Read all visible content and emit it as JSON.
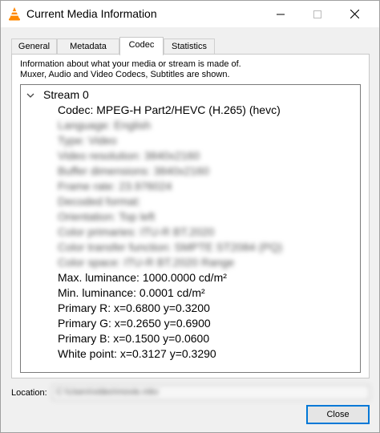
{
  "window": {
    "title": "Current Media Information"
  },
  "tabs": [
    {
      "label": "General",
      "active": false
    },
    {
      "label": "Metadata",
      "active": false
    },
    {
      "label": "Codec",
      "active": true
    },
    {
      "label": "Statistics",
      "active": false
    }
  ],
  "codec": {
    "info_line1": "Information about what your media or stream is made of.",
    "info_line2": "Muxer, Audio and Video Codecs, Subtitles are shown.",
    "stream": {
      "label": "Stream 0",
      "expanded": true,
      "codec": "Codec: MPEG-H Part2/HEVC (H.265) (hevc)",
      "blurred_rows": [
        "Language: English",
        "Type: Video",
        "Video resolution: 3840x2160",
        "Buffer dimensions: 3840x2160",
        "Frame rate: 23.976024",
        "Decoded format:",
        "Orientation: Top left",
        "Color primaries: ITU-R BT.2020",
        "Color transfer function: SMPTE ST2084 (PQ)",
        "Color space: ITU-R BT.2020 Range"
      ],
      "max_luminance": "Max. luminance: 1000.0000 cd/m²",
      "min_luminance": "Min. luminance: 0.0001 cd/m²",
      "primary_r": "Primary R: x=0.6800 y=0.3200",
      "primary_g": "Primary G: x=0.2650 y=0.6900",
      "primary_b": "Primary B: x=0.1500 y=0.0600",
      "white_point": "White point: x=0.3127 y=0.3290"
    }
  },
  "location": {
    "label": "Location:",
    "value": "C:\\Users\\video\\movie.mkv"
  },
  "buttons": {
    "close": "Close"
  }
}
